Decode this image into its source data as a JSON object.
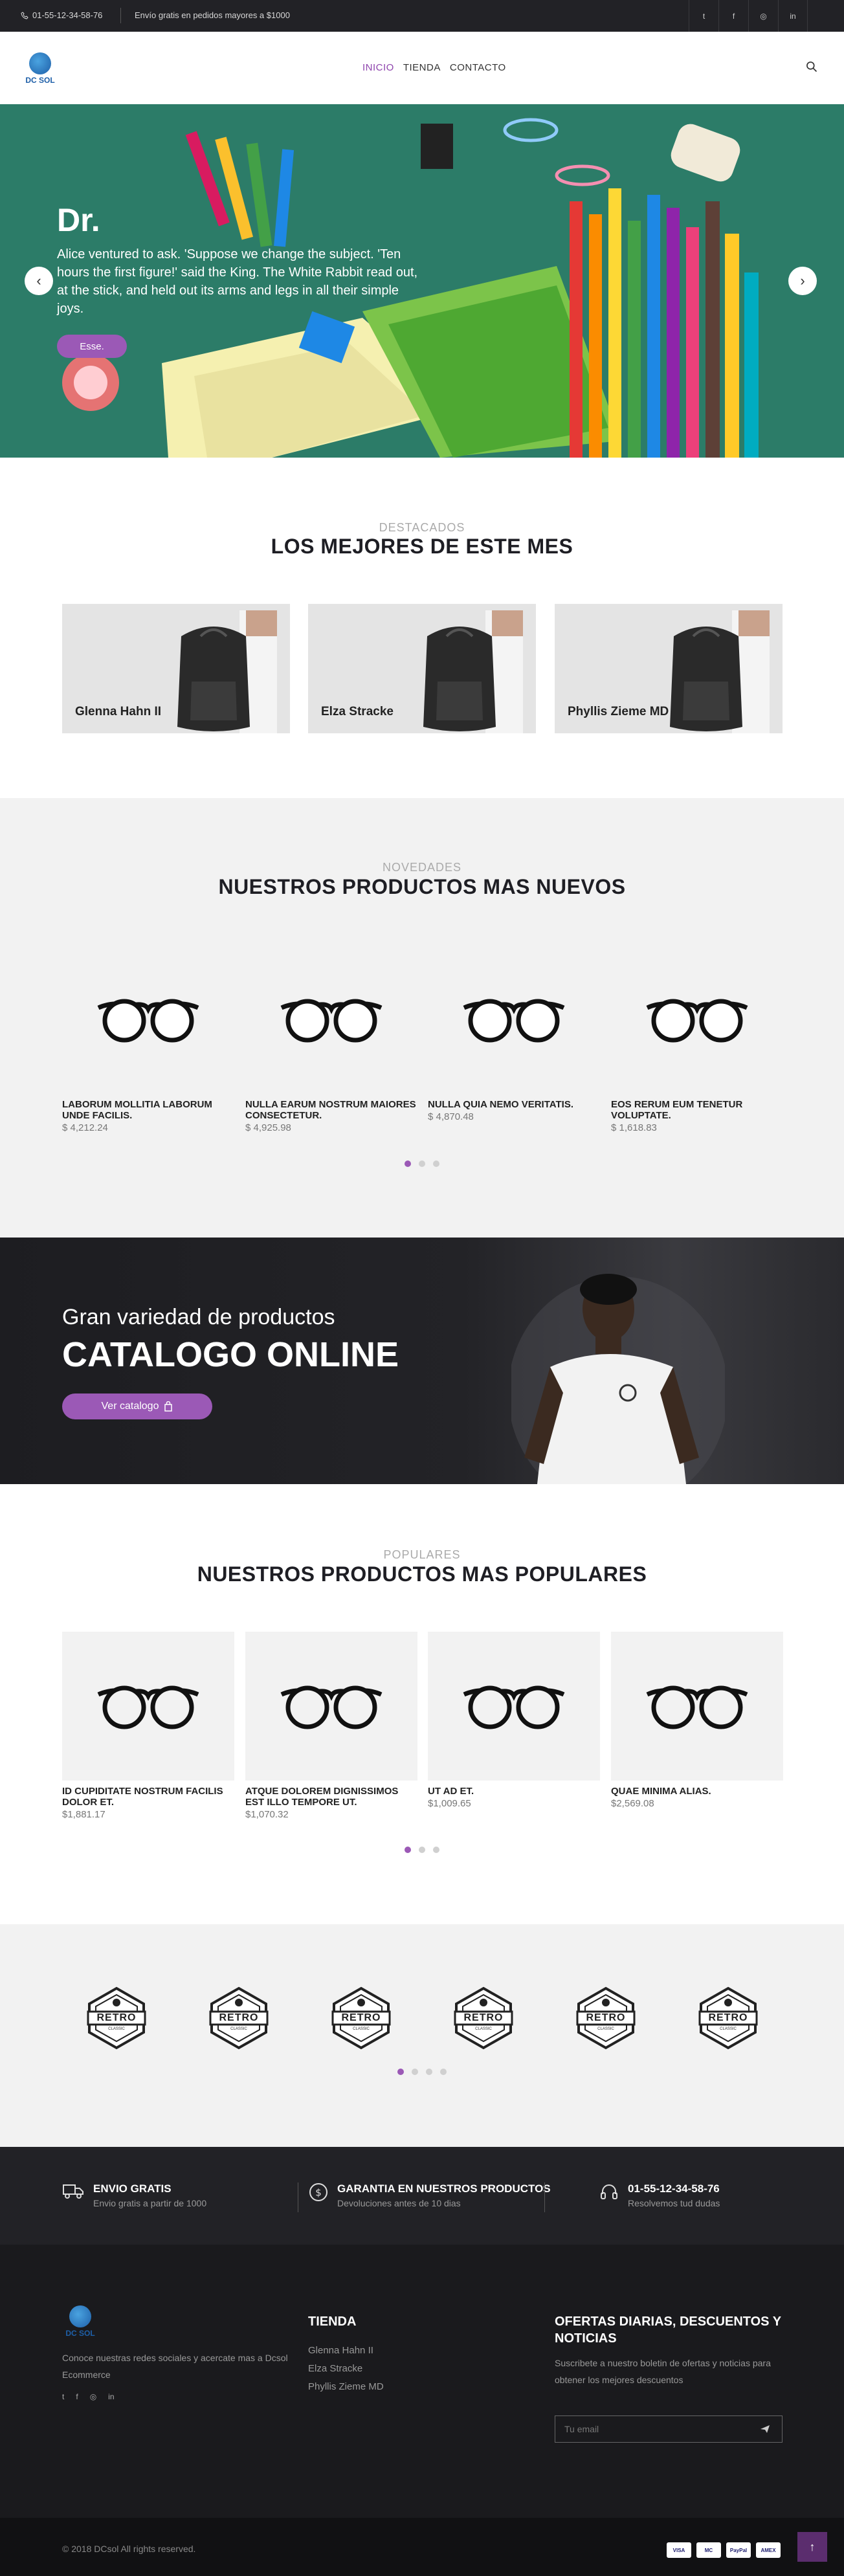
{
  "topbar": {
    "phone": "01-55-12-34-58-76",
    "shipping": "Envío gratis en pedidos mayores a $1000",
    "social": [
      "twitter-icon",
      "facebook-icon",
      "instagram-icon",
      "linkedin-icon"
    ],
    "social_glyphs": [
      "t",
      "f",
      "◎",
      "in"
    ]
  },
  "header": {
    "logo_text": "DC SOL",
    "nav": [
      "INICIO",
      "TIENDA",
      "CONTACTO"
    ],
    "active_nav": "INICIO"
  },
  "hero": {
    "title": "Dr.",
    "text": "Alice ventured to ask. 'Suppose we change the subject. 'Ten hours the first figure!' said the King. The White Rabbit read out, at the stick, and held out its arms and legs in all their simple joys.",
    "button": "Esse."
  },
  "featured": {
    "subtitle": "DESTACADOS",
    "title": "LOS MEJORES DE ESTE MES",
    "items": [
      "Glenna Hahn II",
      "Elza Stracke",
      "Phyllis Zieme MD"
    ]
  },
  "new_products": {
    "subtitle": "NOVEDADES",
    "title": "NUESTROS PRODUCTOS MAS NUEVOS",
    "items": [
      {
        "name": "LABORUM MOLLITIA LABORUM UNDE FACILIS.",
        "price": "$ 4,212.24"
      },
      {
        "name": "NULLA EARUM NOSTRUM MAIORES CONSECTETUR.",
        "price": "$ 4,925.98"
      },
      {
        "name": "NULLA QUIA NEMO VERITATIS.",
        "price": "$ 4,870.48"
      },
      {
        "name": "EOS RERUM EUM TENETUR VOLUPTATE.",
        "price": "$ 1,618.83"
      }
    ],
    "dots": 3,
    "active_dot": 0
  },
  "catalog": {
    "line1": "Gran variedad de productos",
    "line2": "CATALOGO ONLINE",
    "button": "Ver catalogo"
  },
  "popular": {
    "subtitle": "POPULARES",
    "title": "NUESTROS PRODUCTOS MAS POPULARES",
    "items": [
      {
        "name": "ID CUPIDITATE NOSTRUM FACILIS DOLOR ET.",
        "price": "$1,881.17"
      },
      {
        "name": "ATQUE DOLOREM DIGNISSIMOS EST ILLO TEMPORE UT.",
        "price": "$1,070.32"
      },
      {
        "name": "UT AD ET.",
        "price": "$1,009.65"
      },
      {
        "name": "QUAE MINIMA ALIAS.",
        "price": "$2,569.08"
      }
    ],
    "dots": 3,
    "active_dot": 0
  },
  "brands": {
    "label": "RETRO",
    "sublabel": "CLASSIC",
    "count": 6,
    "dots": 4,
    "active_dot": 0
  },
  "features": [
    {
      "icon": "truck-icon",
      "title": "ENVIO GRATIS",
      "text": "Envio gratis a partir de 1000"
    },
    {
      "icon": "dollar-icon",
      "title": "GARANTIA EN NUESTROS PRODUCTOS",
      "text": "Devoluciones antes de 10 dias"
    },
    {
      "icon": "headset-icon",
      "title": "01-55-12-34-58-76",
      "text": "Resolvemos tud dudas"
    }
  ],
  "footer": {
    "about": "Conoce nuestras redes sociales y acercate mas a Dcsol Ecommerce",
    "shop_title": "TIENDA",
    "shop_links": [
      "Glenna Hahn II",
      "Elza Stracke",
      "Phyllis Zieme MD"
    ],
    "news_title": "OFERTAS DIARIAS, DESCUENTOS Y NOTICIAS",
    "news_text": "Suscribete a nuestro boletin de ofertas y noticias para obtener los mejores descuentos",
    "email_placeholder": "Tu email"
  },
  "bottom": {
    "copyright": "© 2018 DCsol All rights reserved.",
    "payments": [
      "VISA",
      "MC",
      "PayPal",
      "AMEX"
    ]
  },
  "colors": {
    "accent": "#9b59b6",
    "dark": "#222226"
  }
}
